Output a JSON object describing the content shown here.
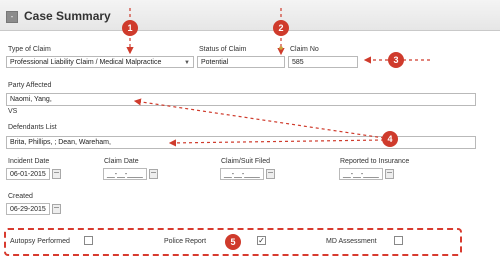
{
  "section": {
    "title": "Case Summary",
    "toggle_symbol": "-"
  },
  "claim": {
    "type_label": "Type of Claim",
    "type_value": "Professional Liability Claim / Medical Malpractice",
    "status_label": "Status of Claim",
    "status_value": "Potential",
    "number_label": "Claim No",
    "number_value": "585"
  },
  "party": {
    "label": "Party Affected",
    "value": "Naomi, Yang,",
    "vs": "VS"
  },
  "defendants": {
    "label": "Defendants List",
    "value": "Brita, Phillips, ; Dean, Wareham,"
  },
  "dates": {
    "incident_label": "Incident Date",
    "incident_value": "06-01-2015",
    "claim_label": "Claim Date",
    "claim_value": "__-__-____",
    "filed_label": "Claim/Suit Filed",
    "filed_value": "__-__-____",
    "insurance_label": "Reported to Insurance",
    "insurance_value": "__-__-____",
    "created_label": "Created",
    "created_value": "06-29-2015"
  },
  "checkboxes": {
    "autopsy_label": "Autopsy Performed",
    "autopsy_checked": false,
    "police_label": "Police Report",
    "police_checked": true,
    "md_label": "MD Assessment",
    "md_checked": false
  },
  "callouts": [
    "1",
    "2",
    "3",
    "4",
    "5"
  ],
  "annotation_color": "#cf3b2c"
}
